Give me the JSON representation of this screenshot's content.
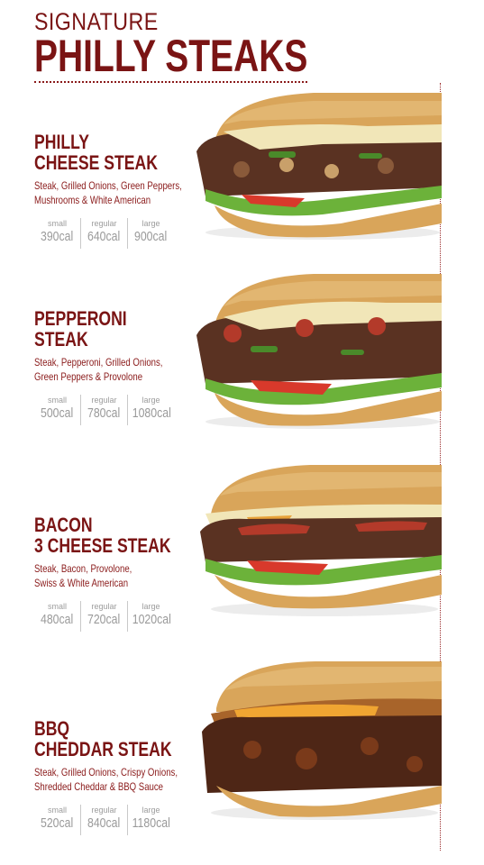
{
  "header": {
    "kicker": "SIGNATURE",
    "title": "PHILLY STEAKS"
  },
  "items": [
    {
      "name_line1": "PHILLY",
      "name_line2": "CHEESE STEAK",
      "desc_line1": "Steak, Grilled Onions, Green Peppers,",
      "desc_line2": "Mushrooms & White American",
      "cals": [
        {
          "size": "small",
          "value": "390cal"
        },
        {
          "size": "regular",
          "value": "640cal"
        },
        {
          "size": "large",
          "value": "900cal"
        }
      ]
    },
    {
      "name_line1": "PEPPERONI",
      "name_line2": "STEAK",
      "desc_line1": "Steak, Pepperoni, Grilled Onions,",
      "desc_line2": "Green Peppers & Provolone",
      "cals": [
        {
          "size": "small",
          "value": "500cal"
        },
        {
          "size": "regular",
          "value": "780cal"
        },
        {
          "size": "large",
          "value": "1080cal"
        }
      ]
    },
    {
      "name_line1": "BACON",
      "name_line2": "3 CHEESE STEAK",
      "desc_line1": "Steak, Bacon, Provolone,",
      "desc_line2": "Swiss & White American",
      "cals": [
        {
          "size": "small",
          "value": "480cal"
        },
        {
          "size": "regular",
          "value": "720cal"
        },
        {
          "size": "large",
          "value": "1020cal"
        }
      ]
    },
    {
      "name_line1": "BBQ",
      "name_line2": "CHEDDAR STEAK",
      "desc_line1": "Steak, Grilled Onions, Crispy Onions,",
      "desc_line2": "Shredded Cheddar & BBQ Sauce",
      "cals": [
        {
          "size": "small",
          "value": "520cal"
        },
        {
          "size": "regular",
          "value": "840cal"
        },
        {
          "size": "large",
          "value": "1180cal"
        }
      ]
    }
  ],
  "colors": {
    "brand": "#7a1414",
    "bread": "#d9a55a",
    "meat": "#5a3222",
    "lettuce": "#6cb23a",
    "tomato": "#d8392b",
    "cheese": "#f1e6b8"
  }
}
